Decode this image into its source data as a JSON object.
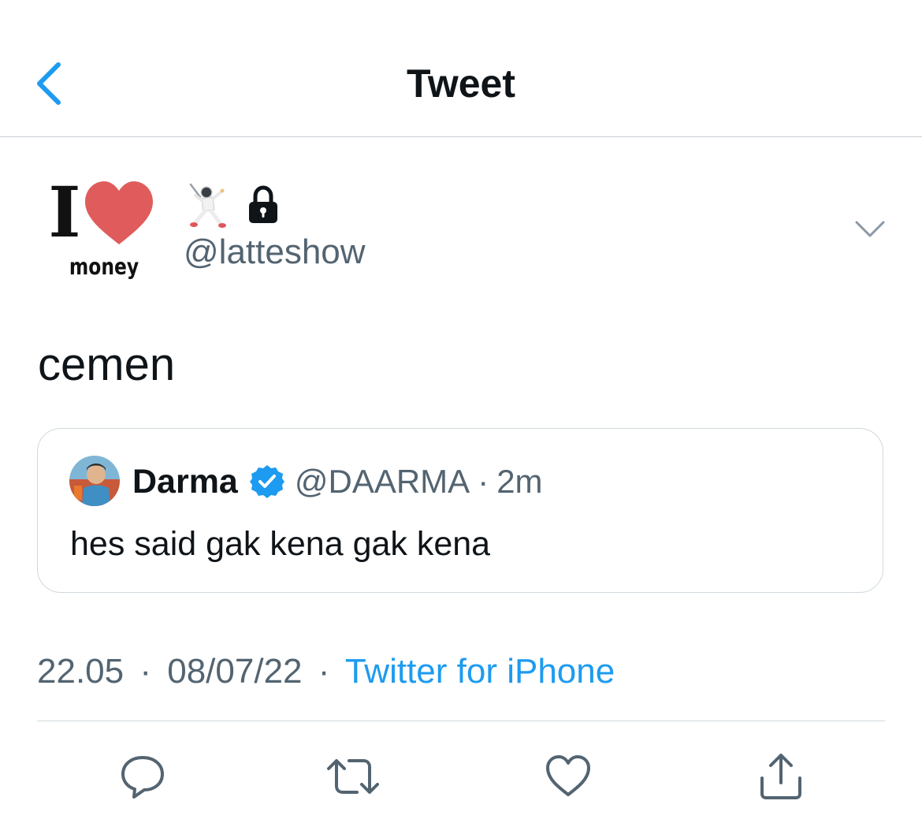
{
  "header": {
    "title": "Tweet",
    "back_icon": "chevron-left-icon"
  },
  "author": {
    "avatar_text_i": "I",
    "avatar_text_money": "money",
    "name_emoji": "fencer-emoji",
    "lock_icon": "lock-icon",
    "handle": "@latteshow"
  },
  "tweet": {
    "text": "cemen"
  },
  "quoted": {
    "name": "Darma",
    "handle": "@DAARMA",
    "dot": "·",
    "time": "2m",
    "text": "hes said gak kena gak kena"
  },
  "meta": {
    "time": "22.05",
    "sep1": "·",
    "date": "08/07/22",
    "sep2": "·",
    "source": "Twitter for iPhone"
  },
  "actions": [
    "reply-icon",
    "retweet-icon",
    "like-icon",
    "share-icon"
  ],
  "colors": {
    "accent": "#1d9bf0",
    "secondary_text": "#536471",
    "heart": "#e05c5c"
  }
}
